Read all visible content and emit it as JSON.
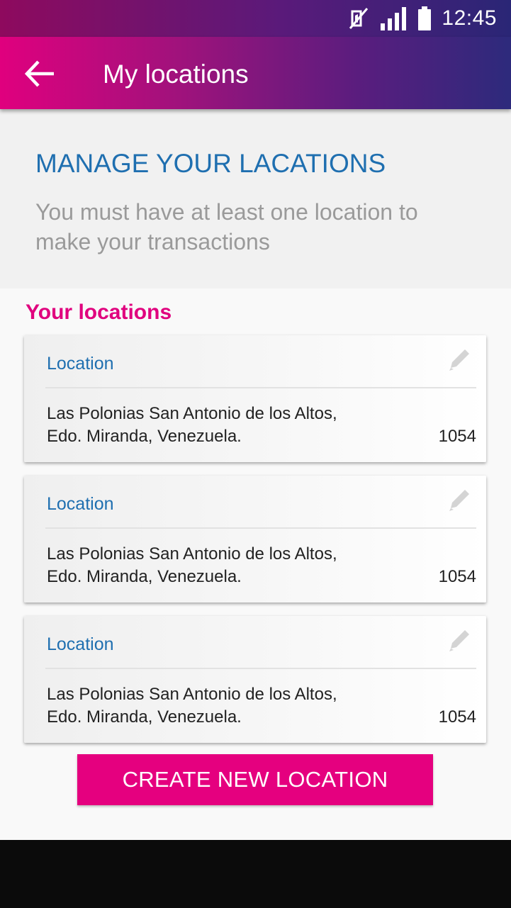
{
  "status_bar": {
    "time": "12:45",
    "icons": [
      "mute-icon",
      "signal-icon",
      "battery-icon"
    ]
  },
  "app_bar": {
    "title": "My locations",
    "back_icon": "arrow-left-icon"
  },
  "intro": {
    "title": "MANAGE YOUR LACATIONS",
    "text": "You must have at least one location to make your transactions"
  },
  "section": {
    "title": "Your locations"
  },
  "locations": [
    {
      "label": "Location",
      "address_line1": "Las Polonias San Antonio de los Altos,",
      "address_line2": "Edo. Miranda, Venezuela.",
      "code": "1054",
      "edit_icon": "pencil-icon"
    },
    {
      "label": "Location",
      "address_line1": "Las Polonias San Antonio de los Altos,",
      "address_line2": "Edo. Miranda, Venezuela.",
      "code": "1054",
      "edit_icon": "pencil-icon"
    },
    {
      "label": "Location",
      "address_line1": "Las Polonias San Antonio de los Altos,",
      "address_line2": "Edo. Miranda, Venezuela.",
      "code": "1054",
      "edit_icon": "pencil-icon"
    }
  ],
  "create_button": {
    "label": "CREATE NEW LOCATION"
  },
  "colors": {
    "accent": "#e5007f",
    "title_blue": "#1f6fb0",
    "gradient_start": "#e0007e",
    "gradient_end": "#2d2a7c"
  }
}
